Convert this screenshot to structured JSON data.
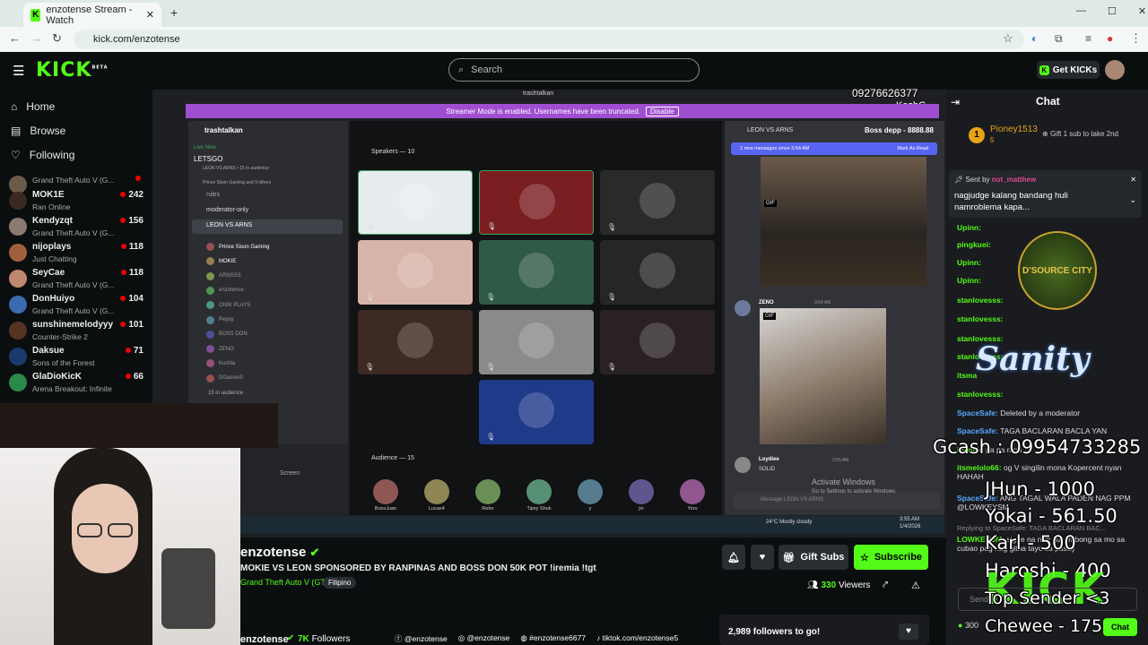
{
  "browser": {
    "tab_title": "enzotense Stream - Watch",
    "url": "kick.com/enzotense"
  },
  "header": {
    "logo": "KICK",
    "logo_beta": "BETA",
    "search_placeholder": "Search",
    "get_kicks": "Get KICKs"
  },
  "nav": {
    "home": "Home",
    "browse": "Browse",
    "following": "Following"
  },
  "channels": [
    {
      "name": "",
      "game": "Grand Theft Auto V (G...",
      "count": "",
      "color": "#6b5a4a"
    },
    {
      "name": "MOK1E",
      "game": "Ran Online",
      "count": "242",
      "color": "#3a2a22"
    },
    {
      "name": "Kendyzqt",
      "game": "Grand Theft Auto V (G...",
      "count": "156",
      "color": "#8a7a70"
    },
    {
      "name": "nijoplays",
      "game": "Just Chatting",
      "count": "118",
      "color": "#a06040"
    },
    {
      "name": "SeyCae",
      "game": "Grand Theft Auto V (G...",
      "count": "118",
      "color": "#c08870"
    },
    {
      "name": "DonHuiyo",
      "game": "Grand Theft Auto V (G...",
      "count": "104",
      "color": "#3a6ab0"
    },
    {
      "name": "sunshinemelodyyy",
      "game": "Counter-Strike 2",
      "count": "101",
      "color": "#553322"
    },
    {
      "name": "Daksue",
      "game": "Sons of the Forest",
      "count": "71",
      "color": "#1a3a6a"
    },
    {
      "name": "GlaDioKicK",
      "game": "Arena Breakout: Infinite",
      "count": "66",
      "color": "#2a8a4a"
    }
  ],
  "stream_overlay": {
    "phone": "09276626377",
    "kash": "KashG",
    "boss_depp": "Boss depp - 8888.88"
  },
  "discord": {
    "server": "trashtalkan",
    "window_title": "trashtalkan",
    "streamer_mode": "Streamer Mode is enabled. Usernames have been truncated.",
    "disable": "Disable",
    "live_now": "Live Now",
    "event": "LETSGO",
    "event_sub": "LEON VS ARNS  •  15 in audience",
    "event_sub2": "Prince Sison Gaming and 9 others",
    "rules": "rules",
    "moderator_only": "moderator-only",
    "stage_channel": "LEON VS ARNS",
    "members": [
      "Prince Sison Gaming",
      "MOKIE",
      "ARNSSS",
      "enzotense",
      "ONIK PLAYS",
      "Pepsy",
      "BOSS DON",
      "ZENO",
      "Kushla",
      "DGames0"
    ],
    "in_audience": "15 in audience",
    "speakers": "Speakers — 10",
    "audience": "Audience — 15",
    "audience_names": [
      "BossJuan",
      "Lucas4",
      "Rebo",
      "Tipsy Shuk",
      "y",
      "jin",
      "Yoru"
    ],
    "screen": "Screen",
    "chat_header": "LEON VS ARNS",
    "new_messages": "2 new messages since 3:54 AM",
    "mark_read": "Mark As Read",
    "gif": "GIF",
    "zeno": "ZENO",
    "zeno_time": "3:54 AM",
    "loydiee": "Loydiee",
    "loydiee_time": "3:55 AM",
    "solid": "SOLID",
    "message_placeholder": "Message LEON VS ARNS",
    "activate_title": "Activate Windows",
    "activate_sub": "Go to Settings to activate Windows.",
    "weather": "24°C  Mostly cloudy",
    "clock": "3:55 AM",
    "date": "1/4/2026"
  },
  "stream_info": {
    "channel": "enzotense",
    "title": "MOKIE VS LEON SPONSORED BY RANPINAS AND BOSS DON 50K POT !iremia !tgt",
    "game": "Grand Theft Auto V (GTA)",
    "tag": "Filipino",
    "viewers": "330",
    "viewers_label": "Viewers",
    "gift_subs": "Gift Subs",
    "subscribe": "Subscribe",
    "followers": "7K",
    "followers_label": "Followers",
    "socials": [
      "@enzotense",
      "@enzotense",
      "#enzotense6677",
      "tiktok.com/enzotense5"
    ],
    "followers_goal": "2,989 followers to go!"
  },
  "chat": {
    "title": "Chat",
    "pinned_user": "Pioney1513",
    "pinned_count": "5",
    "gift_prompt": "Gift 1 sub to take 2nd",
    "sent_by": "Sent by",
    "sent_by_user": "not_matthew",
    "pinned_message": "nagjudge kalang bandang huli namroblema kapa...",
    "messages": [
      {
        "user": "Upinn:",
        "text": ""
      },
      {
        "user": "pingkuei:",
        "text": ""
      },
      {
        "user": "Upinn:",
        "text": ""
      },
      {
        "user": "Upinn:",
        "text": ""
      },
      {
        "user": "stanlovesss:",
        "text": ""
      },
      {
        "user": "stanlovesss:",
        "text": ""
      },
      {
        "user": "stanlovesss:",
        "text": ""
      },
      {
        "user": "stanlovesss:",
        "text": ""
      },
      {
        "user": "itsma",
        "text": ""
      },
      {
        "user": "stanlovesss:",
        "text": ""
      },
      {
        "user": "SpaceSafe:",
        "text": "Deleted by a moderator"
      },
      {
        "user": "SpaceSafe:",
        "text": "TAGA BACLARAN BACLA YAN"
      },
      {
        "user": "itsmelo",
        "text": "pa pa mga"
      },
      {
        "user": "itsmelolo66:",
        "text": "og V singilin mona Kopercent nyan HAHAH"
      },
      {
        "user": "SpaceSafe:",
        "text": "ANG TAGAL WALA PADEN NAG PPM @LOWKEYSM"
      },
      {
        "user": "",
        "text": "Replying to SpaceSafe: TAGA BACLARAN BAC..."
      },
      {
        "user": "LOWKEYSM:",
        "text": "sigee na nag susumbong sa mo sa cubao pag nag gitna tayo sa pasay"
      }
    ],
    "send_label": "Send",
    "chat_button": "Chat",
    "points": "300"
  },
  "donation_overlay": {
    "gcash": "Gcash : 09954733285",
    "lines": [
      "JHun - 1000",
      "Yokai - 561.50",
      "Karl - 500",
      "Haroshi - 400"
    ],
    "top_sender": "Top Sender <3",
    "chewee": "Chewee - 1750",
    "kick_logo": "KICK",
    "dsource_city": "D'SOURCE CITY",
    "sanity": "Sanity"
  },
  "colors": {
    "kick_green": "#53fc18",
    "discord_purple": "#a04ed1",
    "chat_bg": "#191b1f"
  }
}
